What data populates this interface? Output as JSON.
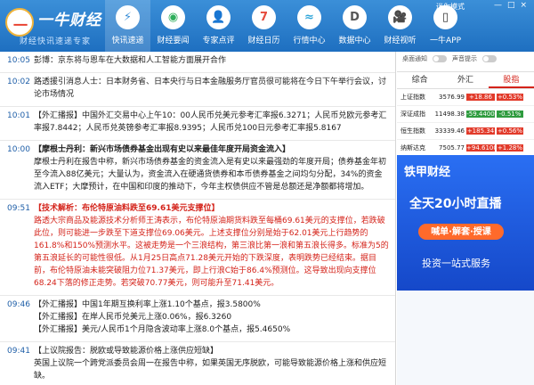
{
  "logo": {
    "glyph": "一",
    "name": "一牛财经",
    "slogan": "财经快讯速递专家"
  },
  "header": {
    "user_label": "迷你模式",
    "window_controls": [
      "—",
      "□",
      "×"
    ]
  },
  "nav": [
    {
      "label": "快讯速递",
      "icon": "lightning-icon",
      "glyph": "⚡",
      "color": "#3b8fd8",
      "active": true
    },
    {
      "label": "财经要闻",
      "icon": "news-icon",
      "glyph": "◉",
      "color": "#2fae5b",
      "active": false
    },
    {
      "label": "专家点评",
      "icon": "expert-icon",
      "glyph": "👤",
      "color": "#3a7fd6",
      "active": false
    },
    {
      "label": "财经日历",
      "icon": "calendar-icon",
      "glyph": "7",
      "color": "#e64b3c",
      "active": false
    },
    {
      "label": "行情中心",
      "icon": "market-icon",
      "glyph": "≈",
      "color": "#2fa5d9",
      "active": false
    },
    {
      "label": "数据中心",
      "icon": "data-icon",
      "glyph": "D",
      "color": "#555555",
      "active": false
    },
    {
      "label": "财经视听",
      "icon": "video-icon",
      "glyph": "🎥",
      "color": "#d14a3a",
      "active": false
    },
    {
      "label": "一牛APP",
      "icon": "phone-icon",
      "glyph": "▯",
      "color": "#333333",
      "active": false
    }
  ],
  "news": [
    {
      "time": "10:05",
      "style": "normal",
      "lines": [
        "彭博：京东将与恩车在大数据和人工智能方面展开合作"
      ]
    },
    {
      "time": "10:02",
      "style": "normal",
      "lines": [
        "路透援引消息人士：日本财务省、日本央行与日本金融服务厅官员很可能将在今日下午举行会议，讨论市场情况"
      ]
    },
    {
      "time": "10:01",
      "style": "normal",
      "lines": [
        "【外汇播报】中国外汇交易中心上午10：00人民币兑美元参考汇率报6.3271；人民币兑欧元参考汇率报7.8442；人民币兑英镑参考汇率报8.9395；人民币兑100日元参考汇率报5.8167"
      ]
    },
    {
      "time": "10:00",
      "style": "bold",
      "lines": [
        "【摩根士丹利：新兴市场债券基金出现有史以来最佳年度开局资金流入】",
        "摩根士丹利在报告中称，新兴市场债券基金的资金流入是有史以来最强劲的年度开局；债券基金年初至今流入88亿美元；大量认为，资金流入在硬通货债券和本币债券基金之间均匀分配，34%的资金流入ETF；大摩预计，在中国和印度的推动下，今年主权债供应不管是总额还是净额都将增加。"
      ]
    },
    {
      "time": "09:51",
      "style": "red",
      "lines": [
        "【技术解析：布伦特原油料跌至69.61美元支撑位】",
        "路透大宗商品及能源技术分析师王涛表示，布伦特原油期货料跌至每桶69.61美元的支撑位，若跌破此位，则可能进一步跌至下道支撑位69.06美元。上述支撑位分别是始于62.01美元上行趋势的161.8%和150%预测水平。这被走势是一个三浪结构，第三浪比第一浪和第五浪长得多。标准为5的第五浪延长的可能性很低。从1月25日高点71.28美元开始的下跌深度，表明跌势已经结束。据目前，布伦特原油未能突破阻力位71.37美元，即上行浪C始于86.4%预测位。这导致出现向支撑位68.24下落的修正走势。若突破70.77美元，则可能升至71.41美元。"
      ]
    },
    {
      "time": "09:46",
      "style": "normal",
      "lines": [
        "【外汇播报】中国1年期互换利率上涨1.10个基点，报3.5800%",
        "【外汇播报】在岸人民币兑美元上涨0.06%，报6.3260",
        "【外汇播报】美元/人民币1个月隐含波动率上涨8.0个基点，报5.4650%"
      ]
    },
    {
      "time": "09:41",
      "style": "normal",
      "lines": [
        "【上议院报告：脱欧或导致能源价格上涨供应短缺】",
        "英国上议院一个跨党派委员会周一在报告中称，如果英国无序脱欧，可能导致能源价格上涨和供应短缺。"
      ]
    }
  ],
  "side": {
    "toggle1": "桌面通知",
    "toggle2": "声音提示",
    "tabs": [
      {
        "label": "综合",
        "active": false
      },
      {
        "label": "外汇",
        "active": false
      },
      {
        "label": "股指",
        "active": true
      }
    ],
    "rows": [
      {
        "name": "上证指数",
        "value": "3576.99",
        "change": "+18.86",
        "pct": "+0.53%",
        "color": "#e23a2a"
      },
      {
        "name": "深证成指",
        "value": "11498.38",
        "change": "-59.4400",
        "pct": "-0.51%",
        "color": "#2e9b3e"
      },
      {
        "name": "恒生指数",
        "value": "33339.46",
        "change": "+185.34",
        "pct": "+0.56%",
        "color": "#e23a2a"
      },
      {
        "name": "纳斯达克",
        "value": "7505.77",
        "change": "+94.6100",
        "pct": "+1.28%",
        "color": "#e23a2a"
      }
    ]
  },
  "ad": {
    "brand": "铁甲财经",
    "title": "全天20小时直播",
    "tag": "喊单·解套·授课",
    "subtitle": "投资一站式服务"
  }
}
